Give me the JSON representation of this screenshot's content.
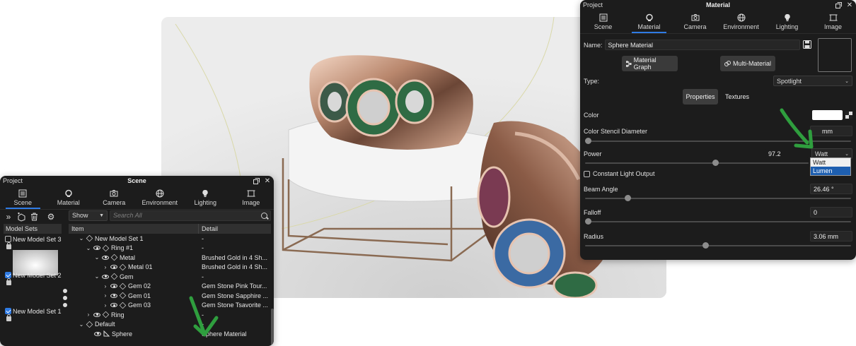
{
  "scene_panel": {
    "title_left": "Project",
    "title": "Scene",
    "tabs": [
      {
        "label": "Scene",
        "icon": "scene-icon",
        "active": true
      },
      {
        "label": "Material",
        "icon": "material-icon",
        "active": false
      },
      {
        "label": "Camera",
        "icon": "camera-icon",
        "active": false
      },
      {
        "label": "Environment",
        "icon": "environment-icon",
        "active": false
      },
      {
        "label": "Lighting",
        "icon": "lighting-icon",
        "active": false
      },
      {
        "label": "Image",
        "icon": "image-icon",
        "active": false
      }
    ],
    "model_sets_header": "Model Sets",
    "model_sets": [
      {
        "name": "New Model Set 3",
        "checked": false
      },
      {
        "name": "New Model Set 2",
        "checked": true
      },
      {
        "name": "New Model Set 1",
        "checked": true
      }
    ],
    "show_select": "Show",
    "search_placeholder": "Search All",
    "columns": {
      "item": "Item",
      "detail": "Detail"
    },
    "tree": [
      {
        "label": "New Model Set 1",
        "detail": "-"
      },
      {
        "label": "Ring #1",
        "detail": "-"
      },
      {
        "label": "Metal",
        "detail": "Brushed Gold in 4 Sh..."
      },
      {
        "label": "Metal 01",
        "detail": "Brushed Gold in 4 Sh..."
      },
      {
        "label": "Gem",
        "detail": "-"
      },
      {
        "label": "Gem 02",
        "detail": "Gem Stone Pink Tour..."
      },
      {
        "label": "Gem 01",
        "detail": "Gem Stone Sapphire ..."
      },
      {
        "label": "Gem 03",
        "detail": "Gem Stone Tsavorite ..."
      },
      {
        "label": "Ring",
        "detail": "-"
      },
      {
        "label": "Default",
        "detail": "-"
      },
      {
        "label": "Sphere",
        "detail": "Sphere Material"
      }
    ]
  },
  "material_panel": {
    "title_left": "Project",
    "title": "Material",
    "tabs": [
      {
        "label": "Scene",
        "icon": "scene-icon",
        "active": false
      },
      {
        "label": "Material",
        "icon": "material-icon",
        "active": true
      },
      {
        "label": "Camera",
        "icon": "camera-icon",
        "active": false
      },
      {
        "label": "Environment",
        "icon": "environment-icon",
        "active": false
      },
      {
        "label": "Lighting",
        "icon": "lighting-icon",
        "active": false
      },
      {
        "label": "Image",
        "icon": "image-icon",
        "active": false
      }
    ],
    "name_label": "Name:",
    "name_value": "Sphere Material",
    "material_graph_button": "Material Graph",
    "multi_material_button": "Multi-Material",
    "type_label": "Type:",
    "type_value": "Spotlight",
    "subtabs": [
      "Properties",
      "Textures"
    ],
    "color_label": "Color",
    "color_value": "#ffffff",
    "stencil_label": "Color Stencil Diameter",
    "stencil_value": "mm",
    "power_label": "Power",
    "power_value": "97.2",
    "power_unit": "Watt",
    "power_unit_options": [
      "Watt",
      "Lumen"
    ],
    "constant_light_label": "Constant Light Output",
    "beam_angle_label": "Beam Angle",
    "beam_angle_value": "26.46 °",
    "falloff_label": "Falloff",
    "falloff_value": "0",
    "radius_label": "Radius",
    "radius_value": "3.06 mm"
  },
  "colors": {
    "panel_bg": "#1c1c1c",
    "accent": "#2f7be4",
    "arrow_green": "#2f9e3e",
    "dropdown_selected": "#1e5fb0"
  }
}
